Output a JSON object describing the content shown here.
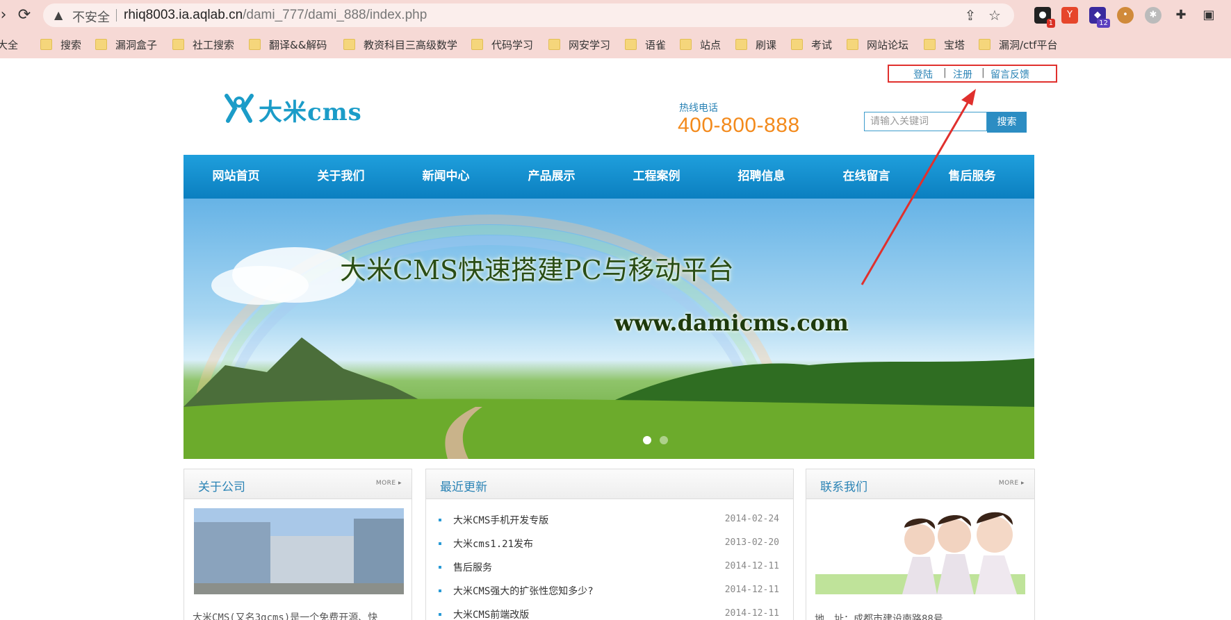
{
  "browser": {
    "insecure_label": "不安全",
    "url_host": "rhiq8003.ia.aqlab.cn",
    "url_path": "/dami_777/dami_888/index.php",
    "extensions": [
      {
        "name": "ext-1",
        "badge": "1"
      },
      {
        "name": "ext-2",
        "badge": ""
      },
      {
        "name": "ext-3",
        "badge": "12"
      }
    ],
    "bookmarks": [
      "大全",
      "搜索",
      "漏洞盒子",
      "社工搜索",
      "翻译&&解码",
      "教资科目三高级数学",
      "代码学习",
      "网安学习",
      "语雀",
      "站点",
      "刷课",
      "考试",
      "网站论坛",
      "宝塔",
      "漏洞/ctf平台"
    ]
  },
  "page": {
    "top_links": {
      "login": "登陆",
      "register": "注册",
      "feedback": "留言反馈",
      "separator": "|"
    },
    "logo_text": "大米cms",
    "hotline_label": "热线电话",
    "hotline_number": "400-800-888",
    "search": {
      "placeholder": "请输入关键词",
      "button": "搜索"
    },
    "nav": [
      "网站首页",
      "关于我们",
      "新闻中心",
      "产品展示",
      "工程案例",
      "招聘信息",
      "在线留言",
      "售后服务"
    ],
    "banner": {
      "title": "大米CMS快速搭建PC与移动平台",
      "url": "www.damicms.com",
      "active_slide": 1,
      "slides": 2
    },
    "about": {
      "title": "关于公司",
      "more": "MORE",
      "text": "大米CMS(又名3gcms)是一个免费开源、快"
    },
    "news": {
      "title": "最近更新",
      "items": [
        {
          "title": "大米CMS手机开发专版",
          "date": "2014-02-24"
        },
        {
          "title": "大米cms1.21发布",
          "date": "2013-02-20"
        },
        {
          "title": "售后服务",
          "date": "2014-12-11"
        },
        {
          "title": "大米CMS强大的扩张性您知多少?",
          "date": "2014-12-11"
        },
        {
          "title": "大米CMS前端改版",
          "date": "2014-12-11"
        }
      ]
    },
    "contact": {
      "title": "联系我们",
      "more": "MORE",
      "address": "地　址：成都市建设南路88号"
    }
  },
  "colors": {
    "nav_blue": "#0b7fc0",
    "link_blue": "#2a83b5",
    "hotline_orange": "#f38a1c",
    "annotation_red": "#e0302d"
  }
}
